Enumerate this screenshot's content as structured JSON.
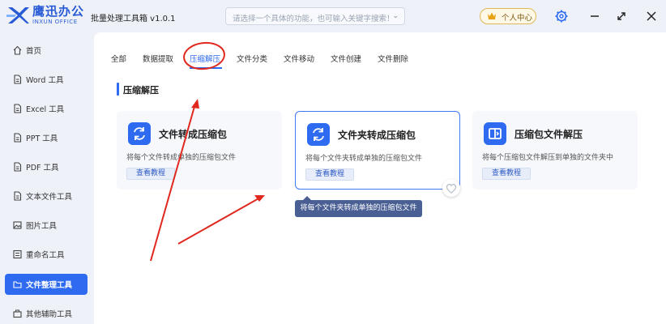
{
  "brand": {
    "name": "鹰迅办公",
    "sub": "INXUN OFFICE"
  },
  "app_title": "批量处理工具箱 v1.0.1",
  "search": {
    "placeholder": "请选择一个具体的功能，也可输入关键字搜索！"
  },
  "user_button": "个人中心",
  "sidebar": {
    "items": [
      {
        "label": "首页"
      },
      {
        "label": "Word 工具"
      },
      {
        "label": "Excel 工具"
      },
      {
        "label": "PPT 工具"
      },
      {
        "label": "PDF 工具"
      },
      {
        "label": "文本文件工具"
      },
      {
        "label": "图片工具"
      },
      {
        "label": "重命名工具"
      },
      {
        "label": "文件整理工具"
      },
      {
        "label": "其他辅助工具"
      }
    ]
  },
  "tabs": [
    {
      "label": "全部"
    },
    {
      "label": "数据提取"
    },
    {
      "label": "压缩解压"
    },
    {
      "label": "文件分类"
    },
    {
      "label": "文件移动"
    },
    {
      "label": "文件创建"
    },
    {
      "label": "文件删除"
    }
  ],
  "section_title": "压缩解压",
  "cards": [
    {
      "title": "文件转成压缩包",
      "desc": "将每个文件转成单独的压缩包文件",
      "button": "查看教程"
    },
    {
      "title": "文件夹转成压缩包",
      "desc": "将每个文件夹转成单独的压缩包文件",
      "button": "查看教程"
    },
    {
      "title": "压缩包文件解压",
      "desc": "将每个压缩包文件解压到单独的文件夹中",
      "button": "查看教程"
    }
  ],
  "tooltip": "将每个文件夹转成单独的压缩包文件",
  "colors": {
    "accent": "#2f6bf0",
    "annotation": "#e0281f",
    "tooltip_bg": "#4a5f94"
  }
}
